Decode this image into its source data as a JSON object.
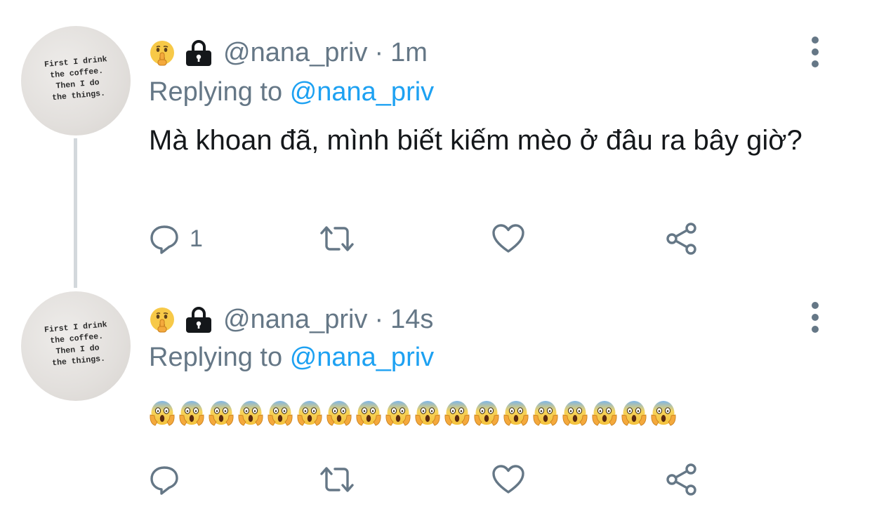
{
  "tweets": [
    {
      "avatar_text": "First I drink\nthe coffee.\nThen I do\nthe things.",
      "handle": "@nana_priv",
      "separator": "·",
      "time": "1m",
      "replying_prefix": "Replying to",
      "replying_to": "@nana_priv",
      "text": "Mà khoan đã, mình biết kiếm mèo ở đâu ra bây giờ?",
      "reply_count": "1",
      "icons": {
        "badge": "shushing-face-emoji",
        "protected": "lock-icon",
        "reply": "reply-icon",
        "retweet": "retweet-icon",
        "like": "heart-icon",
        "share": "share-icon",
        "more": "more-options-icon"
      }
    },
    {
      "avatar_text": "First I drink\nthe coffee.\nThen I do\nthe things.",
      "handle": "@nana_priv",
      "separator": "·",
      "time": "14s",
      "replying_prefix": "Replying to",
      "replying_to": "@nana_priv",
      "emoji_text": "😱😱😱😱😱😱😱😱😱😱😱😱😱😱😱😱😱😱",
      "emoji_count": 18,
      "icons": {
        "badge": "shushing-face-emoji",
        "protected": "lock-icon",
        "reply": "reply-icon",
        "retweet": "retweet-icon",
        "like": "heart-icon",
        "share": "share-icon",
        "more": "more-options-icon"
      }
    }
  ],
  "colors": {
    "text": "#14171a",
    "secondary": "#657786",
    "link": "#1da1f2",
    "thread_line": "#d3d8dc"
  }
}
